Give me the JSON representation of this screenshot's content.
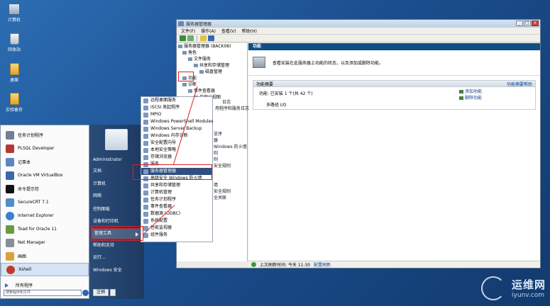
{
  "desktop": {
    "icons": [
      {
        "label": "计算机",
        "icon": "computer-icon"
      },
      {
        "label": "回收站",
        "icon": "recycle-bin-icon"
      },
      {
        "label": "桌面",
        "icon": "folder-icon"
      },
      {
        "label": "实验备存",
        "icon": "folder-icon"
      }
    ]
  },
  "window": {
    "title": "服务器管理器",
    "menu": [
      "文件(F)",
      "操作(A)",
      "查看(V)",
      "帮助(H)"
    ],
    "tree": [
      "服务器管理器 (BACK08)",
      "角色",
      "文件服务",
      "共享和存储管理",
      "磁盘管理",
      "功能",
      "诊断",
      "事件查看器",
      "自定义视图"
    ],
    "header": "功能",
    "description": "查看安装在此服务器上功能的状态，以及添加或删除功能。",
    "summary_title": "功能摘要",
    "summary_help": "功能摘要帮助",
    "feature_summary": "功能: 已安装 1 个(共 42 个)",
    "feature_detail": "多路径 I/O",
    "add_feature": "添加功能",
    "remove_feature": "删除功能",
    "status_last_refresh": "上次刷新时间: 今天 11:30",
    "status_config_refresh": "配置刷新"
  },
  "start_menu": {
    "programs": [
      "任务计划程序",
      "PLSQL Developer",
      "记事本",
      "Oracle VM VirtualBox",
      "命令提示符",
      "SecureCRT 7.1",
      "Internet Explorer",
      "Toad for Oracle 11",
      "Net Manager",
      "画图",
      "Xshell"
    ],
    "all_programs": "所有程序",
    "search_placeholder": "搜索程序和文件",
    "right_items": [
      "Administrator",
      "文档",
      "计算机",
      "网络",
      "控制面板",
      "设备和打印机",
      "管理工具",
      "帮助和支持",
      "运行...",
      "Windows 安全"
    ],
    "logoff": "注销"
  },
  "admin_tools": [
    "远程桌面服务",
    "iSCSI 发起程序",
    "MPIO",
    "Windows PowerShell Modules",
    "Windows Server Backup",
    "Windows 内存诊断",
    "安全配置向导",
    "本地安全策略",
    "存储浏览器",
    "服务",
    "服务器管理器",
    "高级安全 Windows 防火墙",
    "共享和存储管理",
    "计算机管理",
    "任务计划程序",
    "事件查看器",
    "数据源 (ODBC)",
    "系统配置",
    "性能监视器",
    "组件服务"
  ],
  "background_fragments": [
    "日志",
    "用程序和服务日志",
    "",
    "",
    "",
    "呈序",
    "器",
    "Windows 防火墙",
    "则",
    "则",
    "安全规则",
    "",
    "",
    "墙",
    "安全规则",
    "全关联"
  ],
  "watermark": {
    "line1": "运维网",
    "line2": "iyunv.com"
  },
  "colors": {
    "accent": "#0e4f86",
    "highlight": "#2f4f7f",
    "annotation": "#e02020"
  }
}
